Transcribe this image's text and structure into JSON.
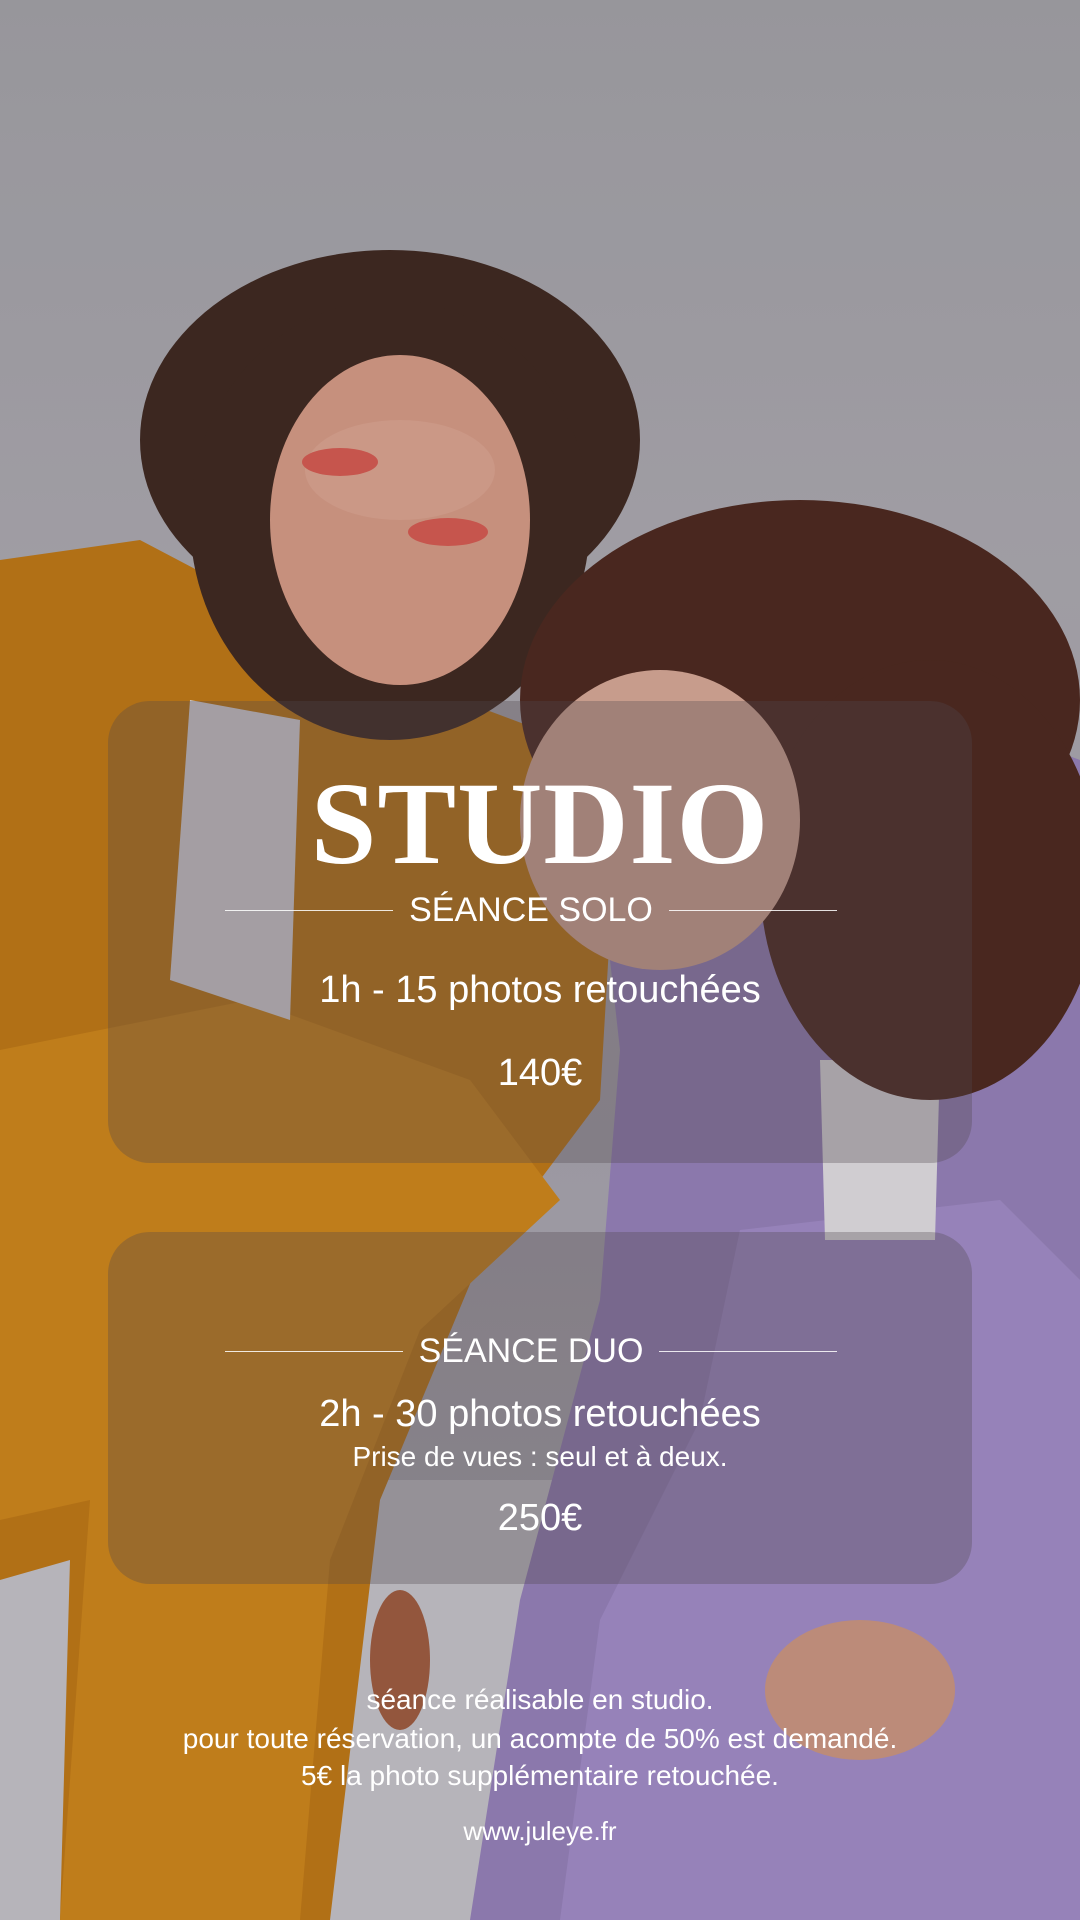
{
  "title": "STUDIO",
  "packages": [
    {
      "heading": "SÉANCE SOLO",
      "details": "1h - 15 photos retouchées",
      "price": "140€"
    },
    {
      "heading": "SÉANCE DUO",
      "details": "2h - 30 photos retouchées",
      "note": "Prise de vues : seul et à deux.",
      "price": "250€"
    }
  ],
  "footer": {
    "lines": [
      "séance réalisable en studio.",
      "pour toute réservation, un acompte de 50% est demandé.",
      "5€ la photo supplémentaire retouchée."
    ],
    "website": "www.juleye.fr"
  },
  "colors": {
    "orange_blazer": "#e8900f",
    "lavender_suit": "#a58ed0",
    "backdrop": "#b0aeb6",
    "text": "#ffffff"
  }
}
